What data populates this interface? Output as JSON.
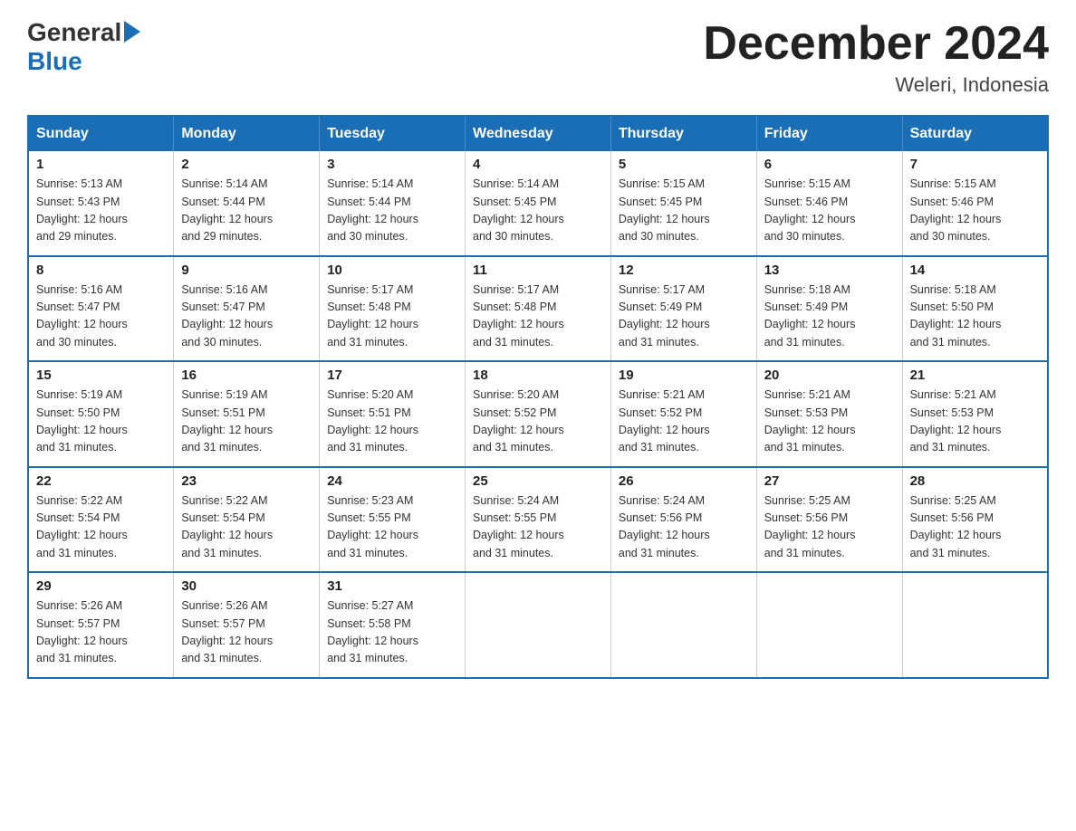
{
  "header": {
    "logo_general": "General",
    "logo_blue": "Blue",
    "month_title": "December 2024",
    "location": "Weleri, Indonesia"
  },
  "weekdays": [
    "Sunday",
    "Monday",
    "Tuesday",
    "Wednesday",
    "Thursday",
    "Friday",
    "Saturday"
  ],
  "weeks": [
    [
      {
        "day": "1",
        "sunrise": "5:13 AM",
        "sunset": "5:43 PM",
        "daylight": "12 hours and 29 minutes."
      },
      {
        "day": "2",
        "sunrise": "5:14 AM",
        "sunset": "5:44 PM",
        "daylight": "12 hours and 29 minutes."
      },
      {
        "day": "3",
        "sunrise": "5:14 AM",
        "sunset": "5:44 PM",
        "daylight": "12 hours and 30 minutes."
      },
      {
        "day": "4",
        "sunrise": "5:14 AM",
        "sunset": "5:45 PM",
        "daylight": "12 hours and 30 minutes."
      },
      {
        "day": "5",
        "sunrise": "5:15 AM",
        "sunset": "5:45 PM",
        "daylight": "12 hours and 30 minutes."
      },
      {
        "day": "6",
        "sunrise": "5:15 AM",
        "sunset": "5:46 PM",
        "daylight": "12 hours and 30 minutes."
      },
      {
        "day": "7",
        "sunrise": "5:15 AM",
        "sunset": "5:46 PM",
        "daylight": "12 hours and 30 minutes."
      }
    ],
    [
      {
        "day": "8",
        "sunrise": "5:16 AM",
        "sunset": "5:47 PM",
        "daylight": "12 hours and 30 minutes."
      },
      {
        "day": "9",
        "sunrise": "5:16 AM",
        "sunset": "5:47 PM",
        "daylight": "12 hours and 30 minutes."
      },
      {
        "day": "10",
        "sunrise": "5:17 AM",
        "sunset": "5:48 PM",
        "daylight": "12 hours and 31 minutes."
      },
      {
        "day": "11",
        "sunrise": "5:17 AM",
        "sunset": "5:48 PM",
        "daylight": "12 hours and 31 minutes."
      },
      {
        "day": "12",
        "sunrise": "5:17 AM",
        "sunset": "5:49 PM",
        "daylight": "12 hours and 31 minutes."
      },
      {
        "day": "13",
        "sunrise": "5:18 AM",
        "sunset": "5:49 PM",
        "daylight": "12 hours and 31 minutes."
      },
      {
        "day": "14",
        "sunrise": "5:18 AM",
        "sunset": "5:50 PM",
        "daylight": "12 hours and 31 minutes."
      }
    ],
    [
      {
        "day": "15",
        "sunrise": "5:19 AM",
        "sunset": "5:50 PM",
        "daylight": "12 hours and 31 minutes."
      },
      {
        "day": "16",
        "sunrise": "5:19 AM",
        "sunset": "5:51 PM",
        "daylight": "12 hours and 31 minutes."
      },
      {
        "day": "17",
        "sunrise": "5:20 AM",
        "sunset": "5:51 PM",
        "daylight": "12 hours and 31 minutes."
      },
      {
        "day": "18",
        "sunrise": "5:20 AM",
        "sunset": "5:52 PM",
        "daylight": "12 hours and 31 minutes."
      },
      {
        "day": "19",
        "sunrise": "5:21 AM",
        "sunset": "5:52 PM",
        "daylight": "12 hours and 31 minutes."
      },
      {
        "day": "20",
        "sunrise": "5:21 AM",
        "sunset": "5:53 PM",
        "daylight": "12 hours and 31 minutes."
      },
      {
        "day": "21",
        "sunrise": "5:21 AM",
        "sunset": "5:53 PM",
        "daylight": "12 hours and 31 minutes."
      }
    ],
    [
      {
        "day": "22",
        "sunrise": "5:22 AM",
        "sunset": "5:54 PM",
        "daylight": "12 hours and 31 minutes."
      },
      {
        "day": "23",
        "sunrise": "5:22 AM",
        "sunset": "5:54 PM",
        "daylight": "12 hours and 31 minutes."
      },
      {
        "day": "24",
        "sunrise": "5:23 AM",
        "sunset": "5:55 PM",
        "daylight": "12 hours and 31 minutes."
      },
      {
        "day": "25",
        "sunrise": "5:24 AM",
        "sunset": "5:55 PM",
        "daylight": "12 hours and 31 minutes."
      },
      {
        "day": "26",
        "sunrise": "5:24 AM",
        "sunset": "5:56 PM",
        "daylight": "12 hours and 31 minutes."
      },
      {
        "day": "27",
        "sunrise": "5:25 AM",
        "sunset": "5:56 PM",
        "daylight": "12 hours and 31 minutes."
      },
      {
        "day": "28",
        "sunrise": "5:25 AM",
        "sunset": "5:56 PM",
        "daylight": "12 hours and 31 minutes."
      }
    ],
    [
      {
        "day": "29",
        "sunrise": "5:26 AM",
        "sunset": "5:57 PM",
        "daylight": "12 hours and 31 minutes."
      },
      {
        "day": "30",
        "sunrise": "5:26 AM",
        "sunset": "5:57 PM",
        "daylight": "12 hours and 31 minutes."
      },
      {
        "day": "31",
        "sunrise": "5:27 AM",
        "sunset": "5:58 PM",
        "daylight": "12 hours and 31 minutes."
      },
      null,
      null,
      null,
      null
    ]
  ],
  "labels": {
    "sunrise_prefix": "Sunrise: ",
    "sunset_prefix": "Sunset: ",
    "daylight_prefix": "Daylight: "
  }
}
